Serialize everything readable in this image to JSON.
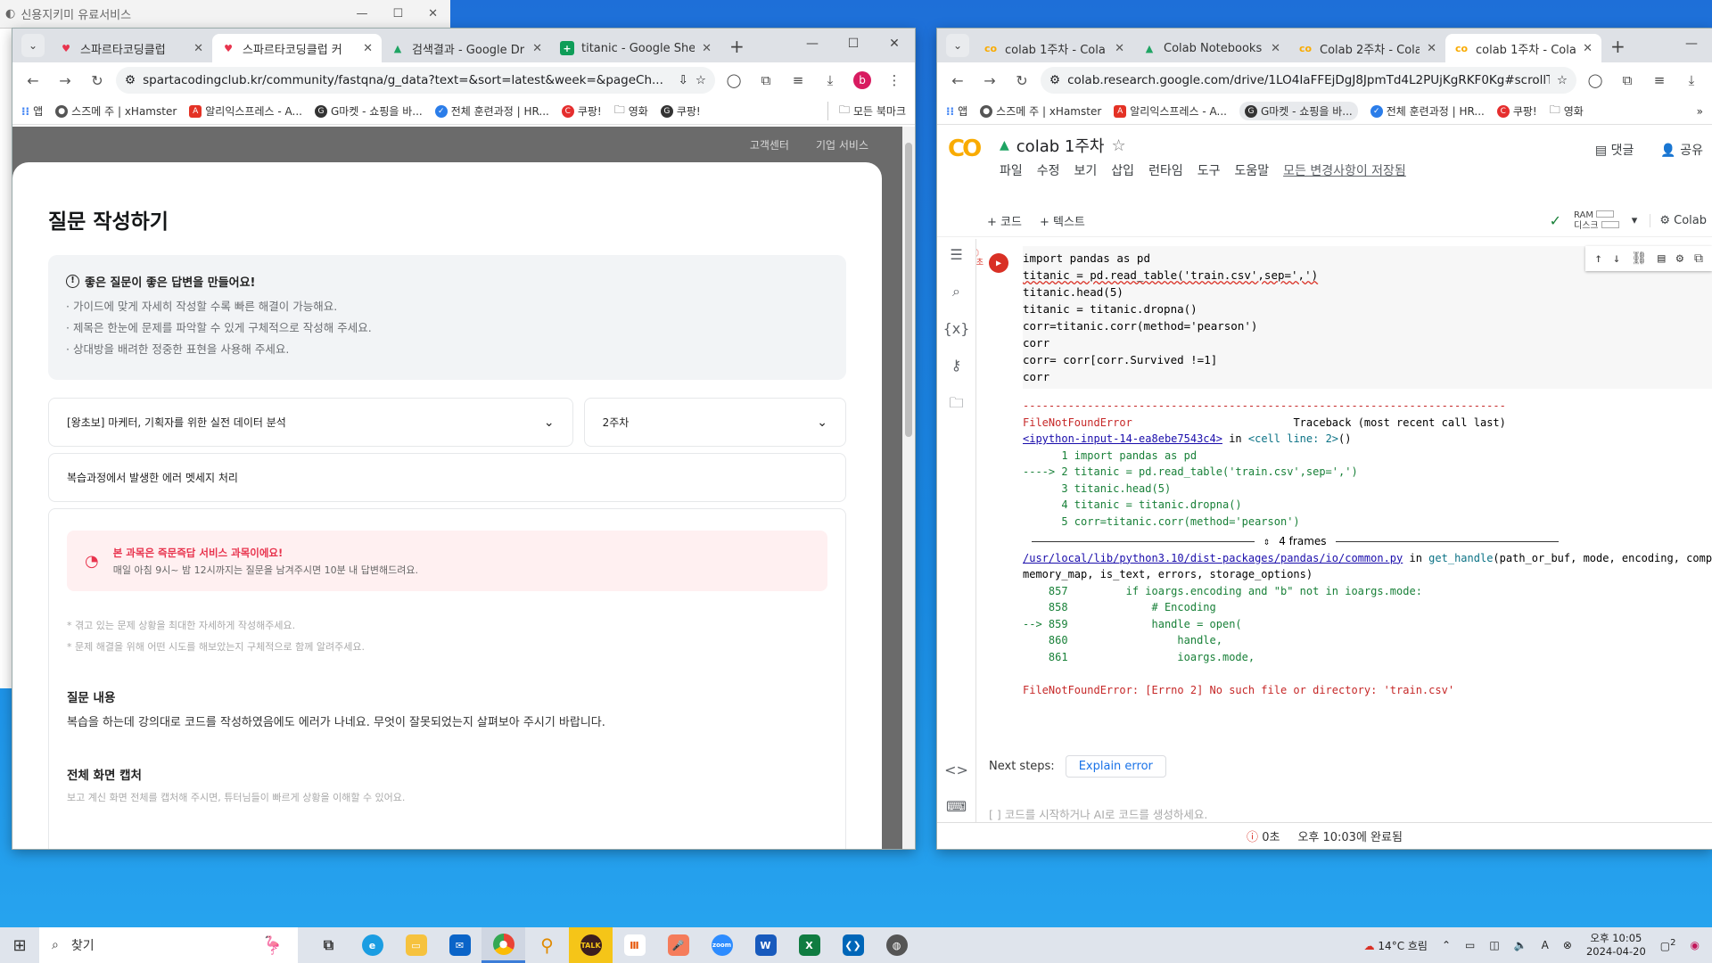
{
  "bgwin": {
    "title": "신용지키미 유료서비스",
    "ctrls": [
      "—",
      "☐",
      "✕"
    ]
  },
  "left": {
    "tabs": [
      {
        "title": "스파르타코딩클럽",
        "fav": "♥",
        "favcolor": "#e8344e"
      },
      {
        "title": "스파르타코딩클럽 커",
        "fav": "♥",
        "favcolor": "#e8344e"
      },
      {
        "title": "검색결과 - Google Dr",
        "fav": "▲",
        "favcolor": "#1fa463"
      },
      {
        "title": "titanic - Google Sheet",
        "fav": "▦",
        "favcolor": "#0f9d58"
      }
    ],
    "url": "spartacodingclub.kr/community/fastqna/g_data?text=&sort=latest&week=&pageCh...",
    "avatar": "b",
    "bookmarks": [
      "앱",
      "스즈메 주 | xHamster",
      "알리익스프레스 - A...",
      "G마켓 - 쇼핑을 바...",
      "전체 훈련과정 | HR...",
      "쿠팡!",
      "영화",
      "쿠팡!"
    ],
    "all_bookmarks": "모든 북마크",
    "topnav": [
      "고객센터",
      "기업 서비스"
    ],
    "page_title": "질문 작성하기",
    "guide": {
      "heading": "좋은 질문이 좋은 답변을 만들어요!",
      "lines": [
        "· 가이드에 맞게 자세히 작성할 수록 빠른 해결이 가능해요.",
        "· 제목은 한눈에 문제를 파악할 수 있게 구체적으로 작성해 주세요.",
        "· 상대방을 배려한 정중한 표현을 사용해 주세요."
      ]
    },
    "course_select": "[왕초보] 마케터, 기획자를 위한 실전 데이터 분석",
    "week_select": "2주차",
    "title_input": "복습과정에서 발생한 에러 멧세지 처리",
    "notice": {
      "title": "본 과목은 즉문즉답 서비스 과목이에요!",
      "body": "매일 아침 9시~ 밤 12시까지는 질문을 남겨주시면 10분 내 답변해드려요."
    },
    "hints": [
      "* 겪고 있는 문제 상황을 최대한 자세하게 작성해주세요.",
      "* 문제 해결을 위해 어떤 시도를 해보았는지 구체적으로 함께 알려주세요."
    ],
    "q_heading": "질문 내용",
    "q_body": "복습을 하는데 강의대로 코드를 작성하였음에도 에러가 나네요. 무엇이 잘못되었는지 살펴보아 주시기 바랍니다.",
    "s_heading": "전체 화면 캡처",
    "s_body": "보고 계신 화면 전체를 캡처해 주시면, 튜터님들이 빠르게 상황을 이해할 수 있어요."
  },
  "right": {
    "tabs": [
      {
        "title": "colab 1주차 - Cola",
        "fav": "co",
        "favcolor": "#f9ab00"
      },
      {
        "title": "Colab Notebooks -",
        "fav": "▲",
        "favcolor": "#1fa463"
      },
      {
        "title": "Colab 2주차 - Cola",
        "fav": "co",
        "favcolor": "#f9ab00"
      },
      {
        "title": "colab 1주차 - Cola",
        "fav": "co",
        "favcolor": "#f9ab00"
      }
    ],
    "url": "colab.research.google.com/drive/1LO4IaFFEjDgJ8JpmTd4L2PUjKgRKF0Kg#scrollTo...",
    "bookmarks": [
      "앱",
      "스즈메 주 | xHamster",
      "알리익스프레스 - A...",
      "G마켓 - 쇼핑을 바...",
      "전체 훈련과정 | HR...",
      "쿠팡!",
      "영화"
    ],
    "logo": "CO",
    "nb_title": "colab 1주차",
    "menu": [
      "파일",
      "수정",
      "보기",
      "삽입",
      "런타임",
      "도구",
      "도움말"
    ],
    "saved": "모든 변경사항이 저장됨",
    "comment": "댓글",
    "share": "공유",
    "add_code": "+ 코드",
    "add_text": "+ 텍스트",
    "ram": "RAM",
    "disk": "디스크",
    "colab_label": "Colab",
    "err_mark": "0초",
    "code_lines": [
      "import pandas as pd",
      "titanic = pd.read_table('train.csv',sep=',')",
      "titanic.head(5)",
      "titanic = titanic.dropna()",
      "corr=titanic.corr(method='pearson')",
      "corr",
      "corr= corr[corr.Survived !=1]",
      "corr"
    ],
    "output": {
      "dashes": "---------------------------------------------------------------------------",
      "err_name": "FileNotFoundError",
      "traceback": "Traceback (most recent call last)",
      "input_ref": "<ipython-input-14-ea8ebe7543c4>",
      "in": " in ",
      "cell_line": "<cell line: 2>",
      "paren": "()",
      "tb_lines": [
        "      1 import pandas as pd",
        "----> 2 titanic = pd.read_table('train.csv',sep=',')",
        "      3 titanic.head(5)",
        "      4 titanic = titanic.dropna()",
        "      5 corr=titanic.corr(method='pearson')"
      ],
      "frames": "4 frames",
      "file_ref": "/usr/local/lib/python3.10/dist-packages/pandas/io/common.py",
      "fn": "get_handle",
      "fn_args1": "(path_or_buf, mode, encoding, compre",
      "fn_args2": "memory_map, is_text, errors, storage_options)",
      "src": [
        "    857         if ioargs.encoding and \"b\" not in ioargs.mode:",
        "    858             # Encoding",
        "--> 859             handle = open(",
        "    860                 handle,",
        "    861                 ioargs.mode,"
      ],
      "final": "FileNotFoundError: [Errno 2] No such file or directory: 'train.csv'"
    },
    "next_steps": "Next steps:",
    "explain": "Explain error",
    "next_cell": "[ ]  코드를 시작하거나 AI로 코드를 생성하세요.",
    "status_time": "0초",
    "status_done": "오후 10:03에 완료됨"
  },
  "taskbar": {
    "search": "찾기",
    "weather": "14°C  흐림",
    "time": "오후 10:05",
    "date": "2024-04-20",
    "notif": "2"
  }
}
